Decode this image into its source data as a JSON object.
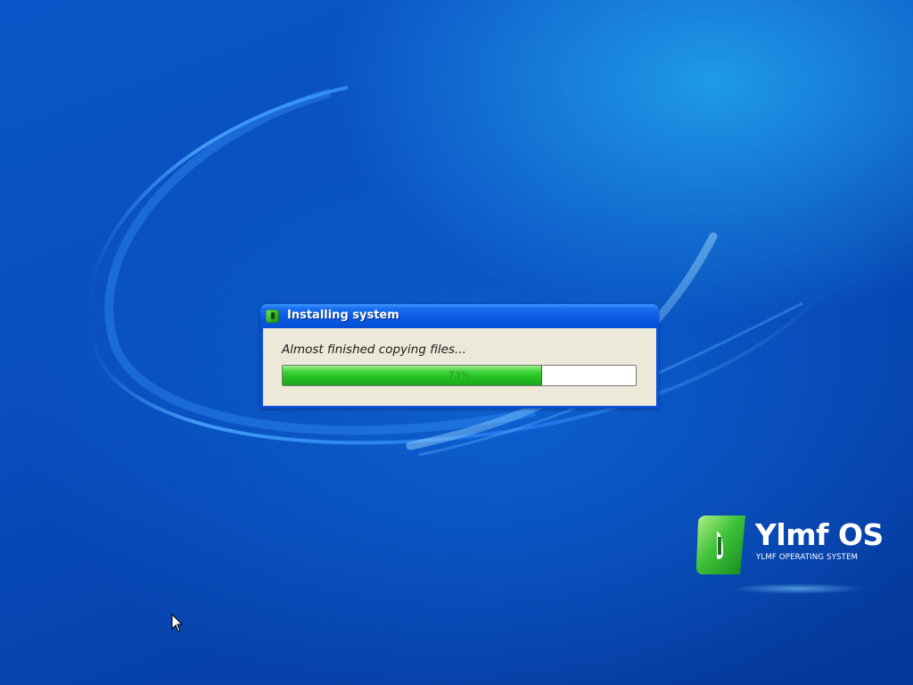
{
  "dialog": {
    "title": "Installing system",
    "status_text": "Almost finished copying files...",
    "progress_fraction": 0.735,
    "progress_label": "73%"
  },
  "logo": {
    "name": "Ylmf OS",
    "subtitle": "YLMF OPERATING SYSTEM",
    "icon": "ylmf-leaf-logo"
  },
  "colors": {
    "desktop_blue": "#0a4fc1",
    "titlebar_blue": "#0a58e2",
    "progress_green": "#22bd22",
    "dialog_face": "#ece9d8"
  }
}
